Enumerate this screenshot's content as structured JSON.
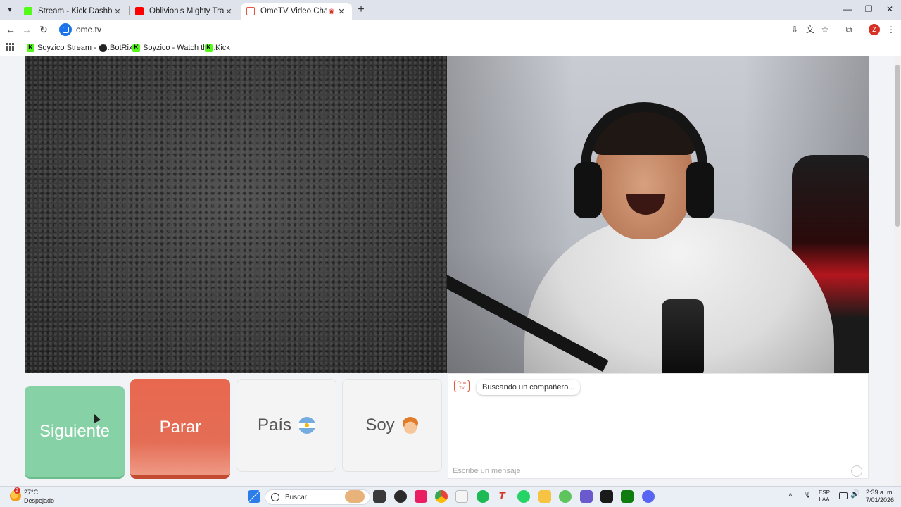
{
  "browser": {
    "tabs": [
      {
        "title": "Stream - Kick Dashboard",
        "favicon": "kick-icon",
        "active": false
      },
      {
        "title": "Oblivion's Mighty Trash - No M",
        "favicon": "youtube-icon",
        "active": false
      },
      {
        "title": "OmeTV Video Chat — Ome",
        "favicon": "ometv-icon",
        "active": true,
        "recording": true
      }
    ],
    "url": "ome.tv",
    "profile_initial": "Z",
    "bookmarks": [
      {
        "label": "Soyzico Stream - W...",
        "icon": "kick-icon"
      },
      {
        "label": "BotRix",
        "icon": "botrix-icon"
      },
      {
        "label": "Soyzico - Watch the...",
        "icon": "kick-icon"
      },
      {
        "label": "Kick",
        "icon": "kick-icon"
      }
    ]
  },
  "ometv": {
    "buttons": {
      "next": "Siguiente",
      "stop": "Parar",
      "country": "País",
      "gender": "Soy"
    },
    "chat": {
      "logo_text": "Ome TV",
      "status": "Buscando un compañero...",
      "input_placeholder": "Escribe un mensaje"
    },
    "colors": {
      "next": "#86d1a5",
      "stop": "#e8684f",
      "neutral": "#f4f4f4"
    }
  },
  "taskbar": {
    "weather_temp": "27°C",
    "weather_desc": "Despejado",
    "search_placeholder": "Buscar",
    "lang_line1": "ESP",
    "lang_line2": "LAA",
    "time": "2:39 a. m.",
    "date": "7/01/2026",
    "weather_badge": "2"
  }
}
